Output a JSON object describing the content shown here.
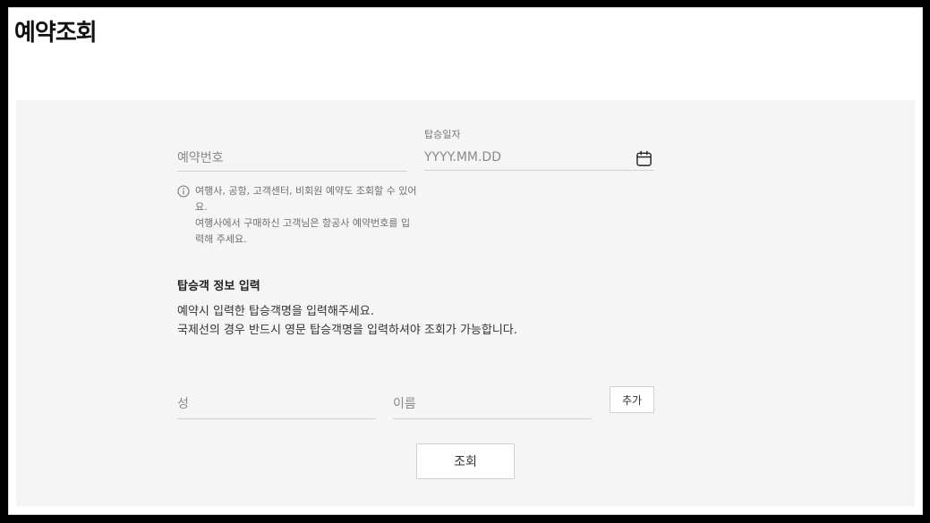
{
  "page": {
    "title": "예약조회"
  },
  "reservation": {
    "number_placeholder": "예약번호",
    "help_lines": [
      "여행사, 공항, 고객센터, 비회원 예약도 조회할 수 있어요.",
      "여행사에서 구매하신 고객님은 항공사 예약번호를 입력해 주세요."
    ]
  },
  "boarding_date": {
    "label": "탑승일자",
    "placeholder": "YYYY.MM.DD",
    "icon": "calendar-icon"
  },
  "passenger": {
    "section_title": "탑승객 정보 입력",
    "desc_lines": [
      "예약시 입력한 탑승객명을 입력해주세요.",
      "국제선의 경우 반드시 영문 탑승객명을 입력하셔야 조회가 가능합니다."
    ],
    "last_name_placeholder": "성",
    "first_name_placeholder": "이름",
    "add_label": "추가"
  },
  "actions": {
    "search_label": "조회"
  },
  "colors": {
    "panel_bg": "#f5f5f5",
    "border": "#d2d2d2",
    "placeholder": "#8a8a8a"
  }
}
